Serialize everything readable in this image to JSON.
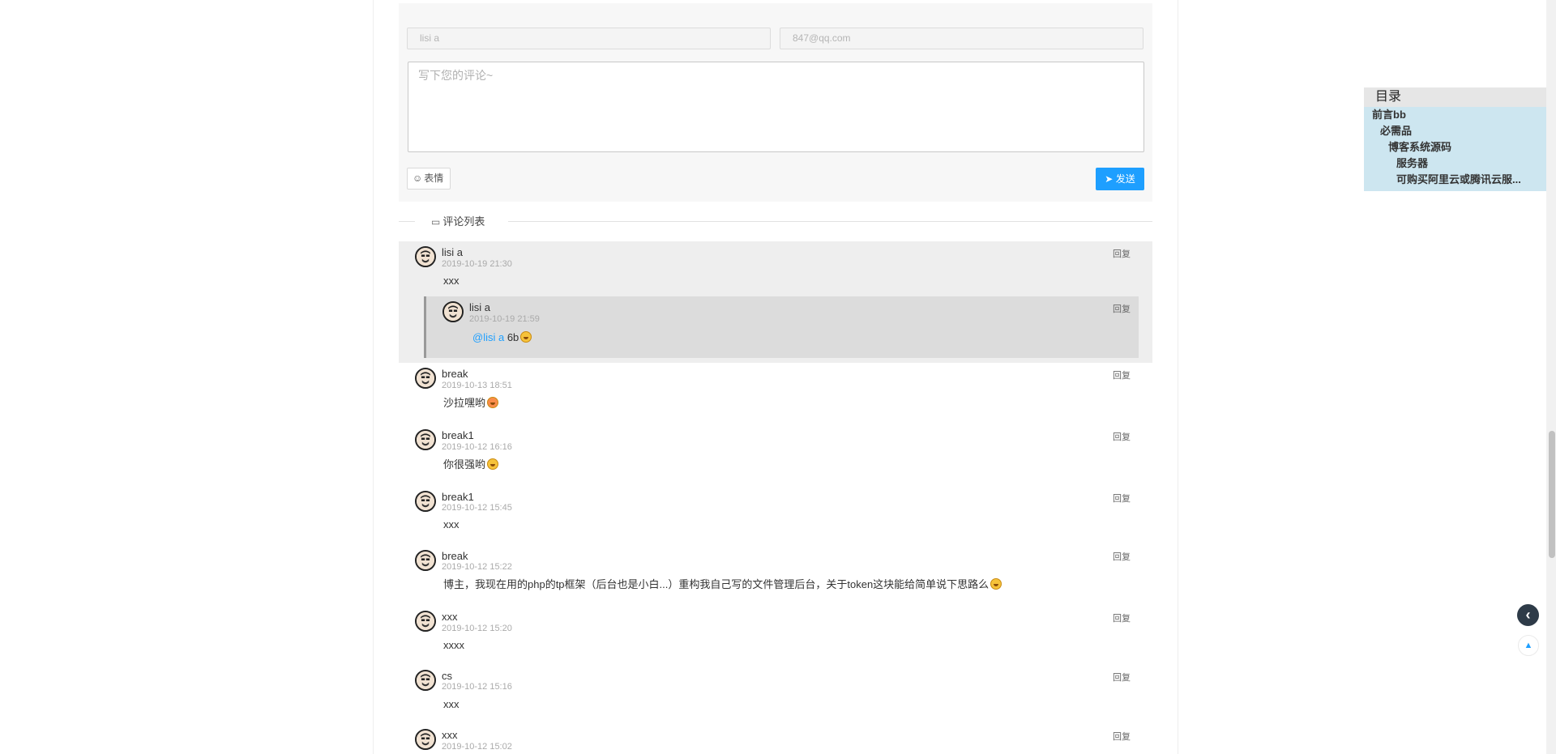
{
  "form": {
    "name_value": "lisi a",
    "email_value": "847@qq.com",
    "comment_placeholder": "写下您的评论~",
    "emoji_label": "表情",
    "send_label": "发送"
  },
  "comment_list_title": "评论列表",
  "comments": [
    {
      "author": "lisi a",
      "time": "2019-10-19 21:30",
      "content": "xxx",
      "reply": "回复"
    },
    {
      "author": "break",
      "time": "2019-10-13 18:51",
      "content": "沙拉嘿哟",
      "reply": "回复"
    },
    {
      "author": "break1",
      "time": "2019-10-12 16:16",
      "content": "你很强哟",
      "reply": "回复"
    },
    {
      "author": "break1",
      "time": "2019-10-12 15:45",
      "content": "xxx",
      "reply": "回复"
    },
    {
      "author": "break",
      "time": "2019-10-12 15:22",
      "content": "博主，我现在用的php的tp框架（后台也是小白...）重构我自己写的文件管理后台，关于token这块能给简单说下思路么",
      "reply": "回复"
    },
    {
      "author": "xxx",
      "time": "2019-10-12 15:20",
      "content": "xxxx",
      "reply": "回复"
    },
    {
      "author": "cs",
      "time": "2019-10-12 15:16",
      "content": "xxx",
      "reply": "回复"
    },
    {
      "author": "xxx",
      "time": "2019-10-12 15:02",
      "content": "",
      "reply": "回复"
    }
  ],
  "nested_reply": {
    "author": "lisi a",
    "time": "2019-10-19 21:59",
    "mention": "@lisi a",
    "content": "6b",
    "reply": "回复"
  },
  "toc": {
    "title": "目录",
    "items": [
      "前言bb",
      "必需品",
      "博客系统源码",
      "服务器",
      "可购买阿里云或腾讯云服..."
    ]
  },
  "colors": {
    "accent": "#1e9fff",
    "highlight": "#eeeeee",
    "toc_bg": "#cde6f0"
  }
}
